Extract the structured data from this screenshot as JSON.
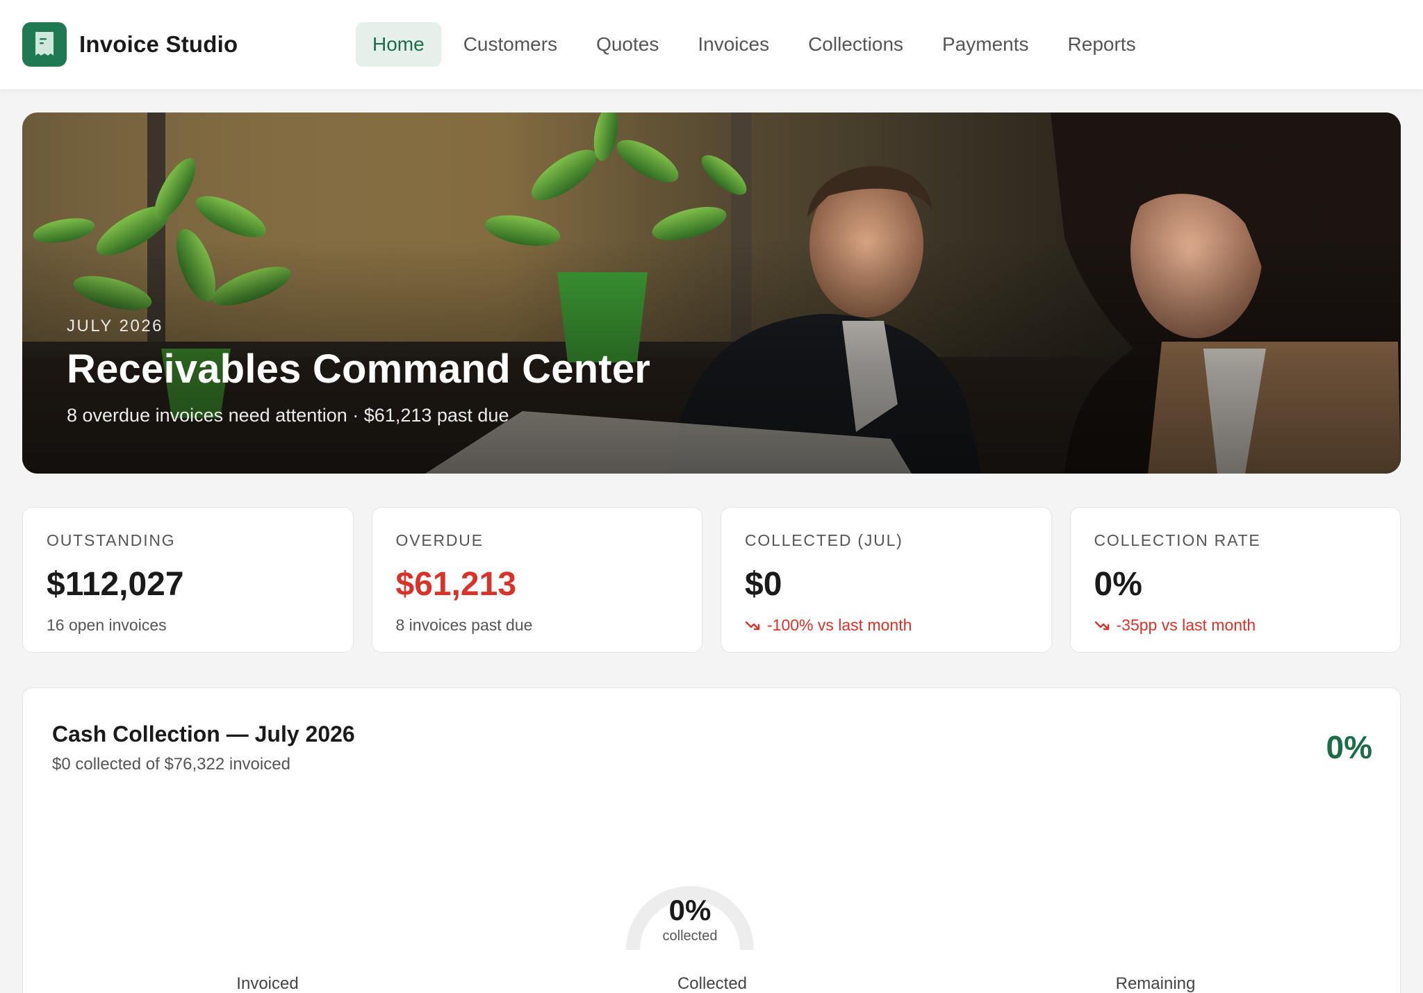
{
  "app": {
    "name": "Invoice Studio",
    "logo_icon": "receipt-icon",
    "accent_color": "#1f7a52"
  },
  "nav": {
    "items": [
      {
        "label": "Home",
        "active": true
      },
      {
        "label": "Customers",
        "active": false
      },
      {
        "label": "Quotes",
        "active": false
      },
      {
        "label": "Invoices",
        "active": false
      },
      {
        "label": "Collections",
        "active": false
      },
      {
        "label": "Payments",
        "active": false
      },
      {
        "label": "Reports",
        "active": false
      }
    ]
  },
  "hero": {
    "kicker": "JULY 2026",
    "title": "Receivables Command Center",
    "subtitle": "8 overdue invoices need attention · $61,213 past due"
  },
  "kpis": [
    {
      "label": "OUTSTANDING",
      "value": "$112,027",
      "sub": "16 open invoices",
      "value_color": "#1a1a1a",
      "trend": null
    },
    {
      "label": "OVERDUE",
      "value": "$61,213",
      "sub": "8 invoices past due",
      "value_color": "#d6332a",
      "trend": null
    },
    {
      "label": "COLLECTED (JUL)",
      "value": "$0",
      "sub": "-100% vs last month",
      "value_color": "#1a1a1a",
      "trend": "trending-down-icon"
    },
    {
      "label": "COLLECTION RATE",
      "value": "0%",
      "sub": "-35pp vs last month",
      "value_color": "#1a1a1a",
      "trend": "trending-down-icon"
    }
  ],
  "cash_collection": {
    "title": "Cash Collection — July 2026",
    "subtitle": "$0 collected of $76,322 invoiced",
    "rate_label": "0%",
    "gauge_value_label": "0%",
    "gauge_caption": "collected",
    "gauge_fraction": 0,
    "legend": [
      "Invoiced",
      "Collected",
      "Remaining"
    ]
  },
  "colors": {
    "negative": "#d6332a",
    "positive": "#1e6b48",
    "gauge_track": "#ededed"
  }
}
